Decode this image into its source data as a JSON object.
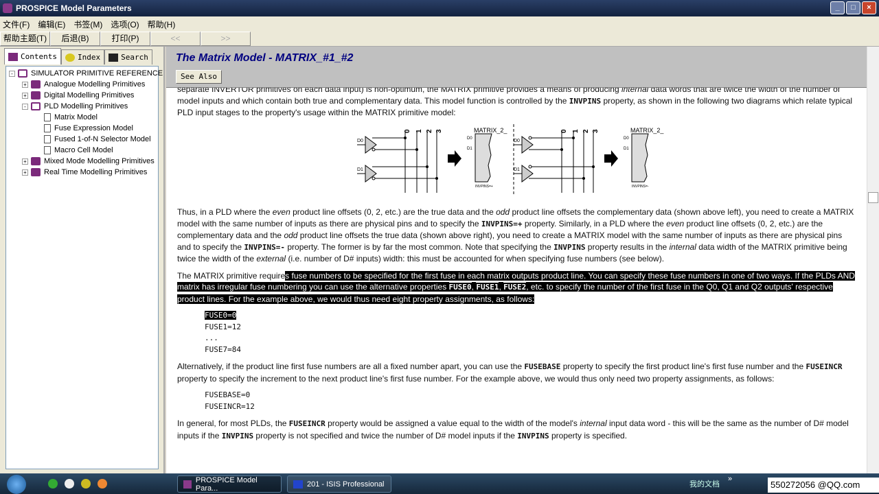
{
  "window": {
    "title": "PROSPICE Model Parameters"
  },
  "menu": [
    "文件(F)",
    "编辑(E)",
    "书签(M)",
    "选项(O)",
    "帮助(H)"
  ],
  "toolbar": [
    "帮助主题(T)",
    "后退(B)",
    "打印(P)",
    "<<",
    ">>"
  ],
  "nav_tabs": [
    "Contents",
    "Index",
    "Search"
  ],
  "tree": [
    {
      "label": "SIMULATOR PRIMITIVE REFERENCE",
      "level": 0,
      "type": "book-open",
      "expander": "-"
    },
    {
      "label": "Analogue Modelling Primitives",
      "level": 1,
      "type": "book",
      "expander": "+"
    },
    {
      "label": "Digital Modelling Primitives",
      "level": 1,
      "type": "book",
      "expander": "+"
    },
    {
      "label": "PLD Modelling Primitives",
      "level": 1,
      "type": "book-open",
      "expander": "-"
    },
    {
      "label": "Matrix Model",
      "level": 2,
      "type": "page"
    },
    {
      "label": "Fuse Expression Model",
      "level": 2,
      "type": "page"
    },
    {
      "label": "Fused 1-of-N Selector Model",
      "level": 2,
      "type": "page"
    },
    {
      "label": "Macro Cell Model",
      "level": 2,
      "type": "page"
    },
    {
      "label": "Mixed Mode Modelling Primitives",
      "level": 1,
      "type": "book",
      "expander": "+"
    },
    {
      "label": "Real Time Modelling Primitives",
      "level": 1,
      "type": "book",
      "expander": "+"
    }
  ],
  "topic": {
    "title": "The Matrix Model - MATRIX_#1_#2",
    "see_also": "See Also",
    "p1": {
      "a": "separate INVERTOR primitives on each data input) is non-optimum, the MATRIX primitive provides a means of producing ",
      "i": "internal",
      "b": " data words that are twice the width of the number of model inputs and which contain both true and complementary data. This model function is controlled by the ",
      "k": "INVPINS",
      "c": " property, as shown in the following two diagrams which relate typical PLD input stages to the property's usage within the MATRIX primitive model:"
    },
    "diagram": {
      "inputs": [
        "D0",
        "D1"
      ],
      "lines": [
        "0",
        "1",
        "2",
        "3"
      ],
      "block_label": "MATRIX_2_",
      "left_prop": "INVPINS=+",
      "right_prop": "INVPINS=-"
    },
    "p2": [
      "Thus, in a PLD where the ",
      "even",
      " product line offsets (0, 2, etc.) are the true data and the ",
      "odd",
      " product line offsets the complementary data (shown above left), you need to create a MATRIX model with the same number of inputs as there are physical pins and to specify the ",
      "INVPINS=+",
      " property. Similarly, in a PLD where the ",
      "even",
      " product line offsets (0, 2, etc.) are the complementary data and the ",
      "odd",
      " product line offsets the true data (shown above right), you need to create a MATRIX model with the same number of inputs as there are physical pins and to specify the ",
      "INVPINS=-",
      " property. The former is by far the most common. Note that specifying the ",
      "INVPINS",
      " property results in the ",
      "internal",
      " data width of the MATRIX primitive being twice the width of the ",
      "external",
      " (i.e. number of D# inputs) width: this must be accounted for when specifying fuse numbers (see below)."
    ],
    "p3": [
      "The MATRIX primitive require",
      "s fuse numbers to be specified for the first fuse in each matrix outputs product line. You can specify these fuse numbers in one of two ways. If the PLDs AND matrix has irregular fuse numbering you can use the alternative properties ",
      "FUSE0",
      ", ",
      "FUSE1",
      ", ",
      "FUSE2",
      ", etc. to specify the number of the first fuse in the Q0, Q1 and Q2 outputs' respective product lines. For the example above, we would thus need eight property assignments, as follows:"
    ],
    "code1": [
      "FUSE0=0",
      "FUSE1=12",
      "...",
      "FUSE7=84"
    ],
    "p4": [
      "Alternatively, if the product line first fuse numbers are all a fixed number apart, you can use the ",
      "FUSEBASE",
      " property to specify the first product line's first fuse number and the ",
      "FUSEINCR",
      " property to specify the increment to the next product line's first fuse number. For the example above, we would thus only need two property assignments, as follows:"
    ],
    "code2": [
      "FUSEBASE=0",
      "FUSEINCR=12"
    ],
    "p5": [
      "In general, for most PLDs, the ",
      "FUSEINCR",
      " property would be assigned a value equal to the width of the model's ",
      "internal",
      " input data word - this will be the same as the number of D# model inputs if the ",
      "INVPINS",
      " property is not specified and twice the number of D# model inputs if the ",
      "INVPINS",
      " property is specified."
    ]
  },
  "taskbar": {
    "tasks": [
      "PROSPICE Model Para...",
      "201 - ISIS Professional"
    ],
    "toolbar_label": "我的文档",
    "overflow": "»",
    "watermark": "550272056 @QQ.com"
  }
}
